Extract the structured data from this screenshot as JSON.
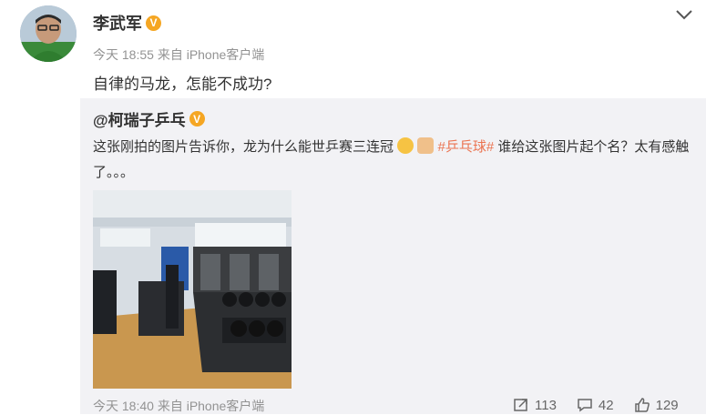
{
  "post": {
    "username": "李武军",
    "verified_badge": "V",
    "meta": "今天 18:55 来自 iPhone客户端",
    "text": "自律的马龙，怎能不成功?"
  },
  "repost": {
    "author": "@柯瑞子乒乓",
    "verified_badge": "V",
    "text_before": "这张刚拍的图片告诉你，龙为什么能世乒赛三连冠",
    "hashtag": "#乒乓球#",
    "text_after": " 谁给这张图片起个名？太有感触了。。。",
    "meta": "今天 18:40 来自 iPhone客户端",
    "stats": {
      "repost_count": "113",
      "comment_count": "42",
      "like_count": "129"
    }
  },
  "icons": {
    "menu": "chevron-down-icon",
    "repost": "repost-icon",
    "comment": "comment-icon",
    "like": "like-icon"
  },
  "colors": {
    "accent_orange": "#eb7350",
    "badge": "#f5a623",
    "meta_gray": "#939393",
    "repost_bg": "#f2f2f5"
  }
}
